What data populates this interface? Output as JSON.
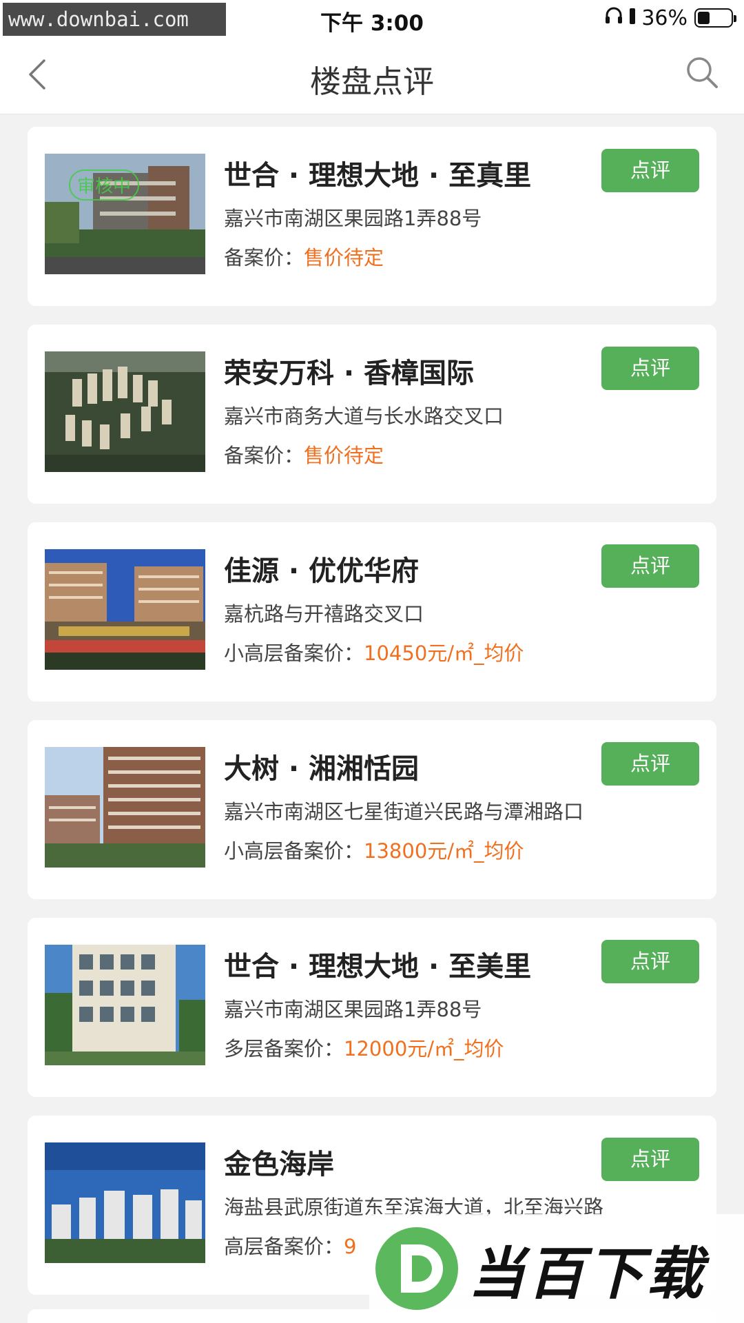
{
  "status_bar": {
    "watermark": "www.downbai.com",
    "time": "下午 3:00",
    "battery": "36%",
    "battery_level": 0.36
  },
  "nav": {
    "title": "楼盘点评",
    "back_icon": "chevron-left-icon",
    "search_icon": "search-icon"
  },
  "accent_color": "#56b05a",
  "price_color": "#f07020",
  "listings": [
    {
      "title": "世合 · 理想大地 · 至真里",
      "address": "嘉兴市南湖区果园路1弄88号",
      "price_label": "备案价：",
      "price_value": "售价待定",
      "button": "点评",
      "stamp": "审核中"
    },
    {
      "title": "荣安万科 · 香樟国际",
      "address": "嘉兴市商务大道与长水路交叉口",
      "price_label": "备案价：",
      "price_value": "售价待定",
      "button": "点评"
    },
    {
      "title": "佳源 · 优优华府",
      "address": "嘉杭路与开禧路交叉口",
      "price_label": "小高层备案价：",
      "price_value": "10450元/㎡_均价",
      "button": "点评"
    },
    {
      "title": "大树 · 湘湘恬园",
      "address": "嘉兴市南湖区七星街道兴民路与潭湘路口",
      "price_label": "小高层备案价：",
      "price_value": "13800元/㎡_均价",
      "button": "点评"
    },
    {
      "title": "世合 · 理想大地 · 至美里",
      "address": "嘉兴市南湖区果园路1弄88号",
      "price_label": "多层备案价：",
      "price_value": "12000元/㎡_均价",
      "button": "点评"
    },
    {
      "title": "金色海岸",
      "address": "海盐县武原街道东至滨海大道，北至海兴路",
      "price_label": "高层备案价：",
      "price_value": "9",
      "button": "点评"
    }
  ],
  "bottom_watermark": "当百下载"
}
